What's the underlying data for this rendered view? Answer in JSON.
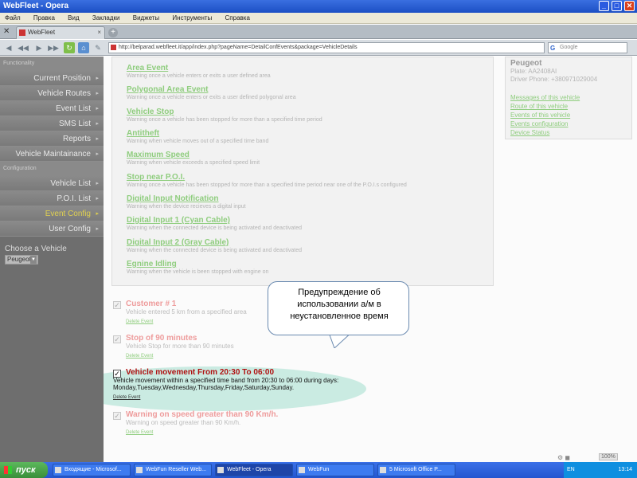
{
  "window": {
    "title": "WebFleet - Opera",
    "min_label": "_",
    "max_label": "□",
    "close_label": "✕"
  },
  "menu": [
    "Файл",
    "Правка",
    "Вид",
    "Закладки",
    "Виджеты",
    "Инструменты",
    "Справка"
  ],
  "tabbar": {
    "tools_label": "✕",
    "tab_label": "WebFleet",
    "tab_close": "×",
    "new_tab": "+"
  },
  "address": {
    "url": "http://belparad.webfleet.it/app/index.php?pageName=DetailConfEvents&package=VehicleDetails",
    "search_placeholder": "Google",
    "search_badge": "G"
  },
  "sidebar": {
    "functionality_header": "Functionality",
    "functionality_items": [
      {
        "label": "Current Position",
        "active": false
      },
      {
        "label": "Vehicle Routes",
        "active": false
      },
      {
        "label": "Event List",
        "active": false
      },
      {
        "label": "SMS List",
        "active": false
      },
      {
        "label": "Reports",
        "active": false
      },
      {
        "label": "Vehicle Maintainance",
        "active": false
      }
    ],
    "configuration_header": "Configuration",
    "configuration_items": [
      {
        "label": "Vehicle List",
        "active": false
      },
      {
        "label": "P.O.I. List",
        "active": false
      },
      {
        "label": "Event Config",
        "active": true
      },
      {
        "label": "User Config",
        "active": false
      }
    ],
    "choose_label": "Choose a Vehicle",
    "choose_value": "Peugeot"
  },
  "event_types": [
    {
      "title": "Area Event",
      "desc": "Warning once a vehicle enters or exits a user defined area"
    },
    {
      "title": "Polygonal Area Event",
      "desc": "Warning once a vehicle enters or exits a user defined polygonal area"
    },
    {
      "title": "Vehicle Stop",
      "desc": "Warning once a vehicle has been stopped for more than a specified time period"
    },
    {
      "title": "Antitheft",
      "desc": "Warning when vehicle moves out of a specified time band"
    },
    {
      "title": "Maximum Speed",
      "desc": "Warning when vehicle exceeds a specified speed limit"
    },
    {
      "title": "Stop near P.O.I.",
      "desc": "Warning once a vehicle has been stopped for more than a specified time period near one of the P.O.I.s configured"
    },
    {
      "title": "Digital Input Notification",
      "desc": "Warning when the device recieves a digital input"
    },
    {
      "title": "Digital Input 1 (Cyan Cable)",
      "desc": "Warning when the connected device is being activated and deactivated"
    },
    {
      "title": "Digital Input 2 (Gray Cable)",
      "desc": "Warning when the connected device is being activated and deactivated"
    },
    {
      "title": "Egnine Idling",
      "desc": "Warning when the vehicle is been stopped with engine on"
    }
  ],
  "vehicle": {
    "name": "Peugeot",
    "plate": "Plate: AA2408AI",
    "phone": "Driver Phone: +380971029004",
    "links": [
      "Messages of this vehicle",
      "Route of this vehicle",
      "Events of this vehicle",
      "Events configuration",
      "Device Status"
    ]
  },
  "configured_events": [
    {
      "title": "Customer # 1",
      "desc1": "Vehicle entered 5 km from a specified area",
      "desc2": "",
      "delete": "Delete Event",
      "checked": true,
      "highlight": false
    },
    {
      "title": "Stop of 90 minutes",
      "desc1": "Vehicle Stop for more than 90 minutes",
      "desc2": "",
      "delete": "Delete Event",
      "checked": true,
      "highlight": false
    },
    {
      "title": "Vehicle movement From 20:30 To 06:00",
      "desc1": "Vehicle movement within a specified time band from 20:30 to 06:00 during days:",
      "desc2": "Monday,Tuesday,Wednesday,Thursday,Friday,Saturday,Sunday.",
      "delete": "Delete Event",
      "checked": true,
      "highlight": true
    },
    {
      "title": "Warning on speed greater than 90 Km/h.",
      "desc1": "Warning on speed greater than 90 Km/h.",
      "desc2": "",
      "delete": "Delete Event",
      "checked": true,
      "highlight": false
    }
  ],
  "checkmark": "✓",
  "callout": {
    "line1": "Предупреждение об",
    "line2": "использовании а/м в",
    "line3": "неустановленное время"
  },
  "status": {
    "icons": "⚙ ◼",
    "zoom": "100%"
  },
  "taskbar": {
    "start": "пуск",
    "tasks": [
      {
        "label": "Входящие - Microsof...",
        "active": false
      },
      {
        "label": "WebFun Reseller Web...",
        "active": false
      },
      {
        "label": "WebFleet - Opera",
        "active": true
      },
      {
        "label": "WebFun",
        "active": false
      },
      {
        "label": "5 Microsoft Office P...",
        "active": false
      }
    ],
    "lang": "EN",
    "clock": "13:14"
  },
  "colors": {
    "link_green": "#8fcd7e",
    "alarm_red": "#b01010",
    "sidebar_gray": "#6e6e6e",
    "active_yellow": "#e0d050"
  }
}
